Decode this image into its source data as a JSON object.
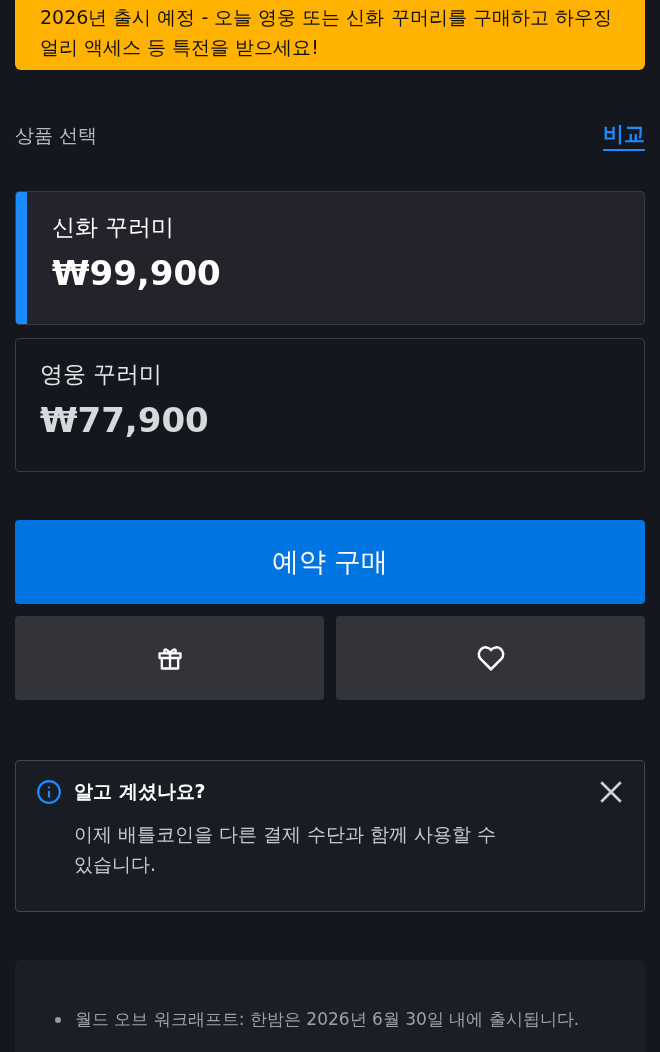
{
  "banner": {
    "text": "2026년 출시 예정 - 오늘 영웅 또는 신화 꾸머리를 구매하고 하우징 얼리 액세스 등 특전을 받으세요!"
  },
  "product_section": {
    "label": "상품 선택",
    "compare_link": "비교"
  },
  "products": [
    {
      "name": "신화 꾸러미",
      "price": "₩99,900",
      "selected": true
    },
    {
      "name": "영웅 꾸러미",
      "price": "₩77,900",
      "selected": false
    }
  ],
  "buy_button": "예약 구매",
  "secondary_buttons": [
    {
      "kind": "gift"
    },
    {
      "kind": "wishlist"
    }
  ],
  "notice": {
    "title": "알고 계셨나요?",
    "body": "이제 배틀코인을 다른 결제 수단과 함께 사용할 수 있습니다."
  },
  "details": {
    "bullets": [
      "월드 오브 워크래프트: 한밤은 2026년 6월 30일 내에 출시됩니다."
    ]
  }
}
